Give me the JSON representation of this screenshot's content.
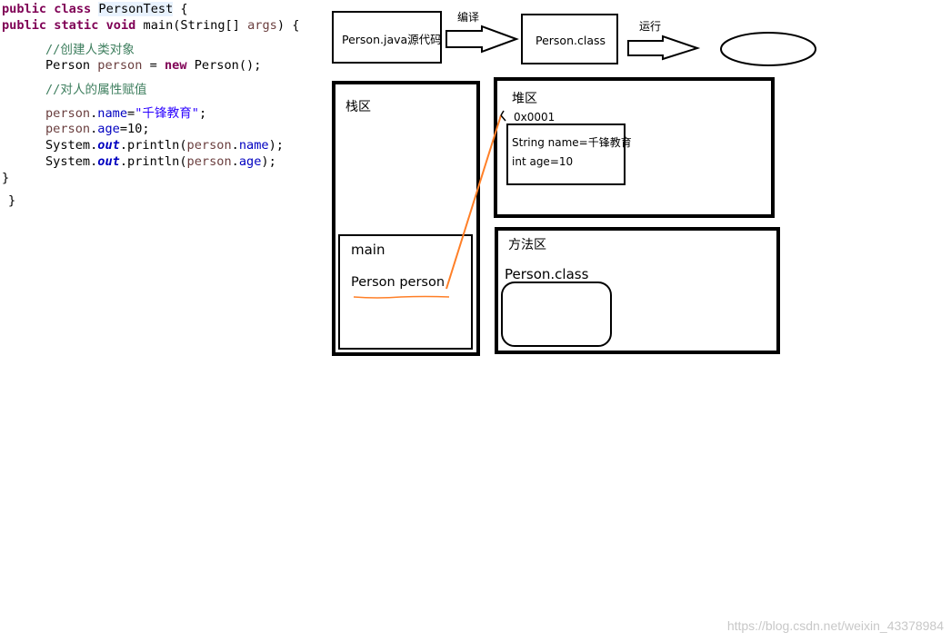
{
  "code": {
    "l1": {
      "kw": "public class",
      "name": "PersonTest",
      "brace": " {"
    },
    "l2": {
      "kw": "public static void",
      "rest": " main(String[] ",
      "param": "args",
      "end": ") {"
    },
    "l3": "//创建人类对象",
    "l4": {
      "type": "Person ",
      "var": "person",
      "eq": " = ",
      "kw": "new",
      "rest": " Person();"
    },
    "l5": "//对人的属性赋值",
    "l6": {
      "var": "person",
      "dot": ".",
      "fld": "name",
      "eq": "=",
      "str": "\"千锋教育\"",
      "end": ";"
    },
    "l7": {
      "var": "person",
      "dot": ".",
      "fld": "age",
      "rest": "=10;"
    },
    "l8": {
      "pre": "System.",
      "sfld": "out",
      "mid": ".println(",
      "var": "person",
      "dot": ".",
      "fld": "name",
      "end": ");"
    },
    "l9": {
      "pre": "System.",
      "sfld": "out",
      "mid": ".println(",
      "var": "person",
      "dot": ".",
      "fld": "age",
      "end": ");"
    },
    "l10": "}",
    "l11": "}"
  },
  "diagram": {
    "source_box": "Person.java源代码",
    "compile_label": "编译",
    "class_box": "Person.class",
    "run_label": "运行",
    "stack_title": "栈区",
    "main_frame_title": "main",
    "main_frame_var": "Person person",
    "heap_title": "堆区",
    "address": "0x0001",
    "heap_field_name": "String name=千锋教育",
    "heap_field_age": "int age=10",
    "method_area_title": "方法区",
    "method_area_class": "Person.class"
  },
  "watermark": "https://blog.csdn.net/weixin_43378984",
  "colors": {
    "reference_line": "#ff7f27"
  }
}
